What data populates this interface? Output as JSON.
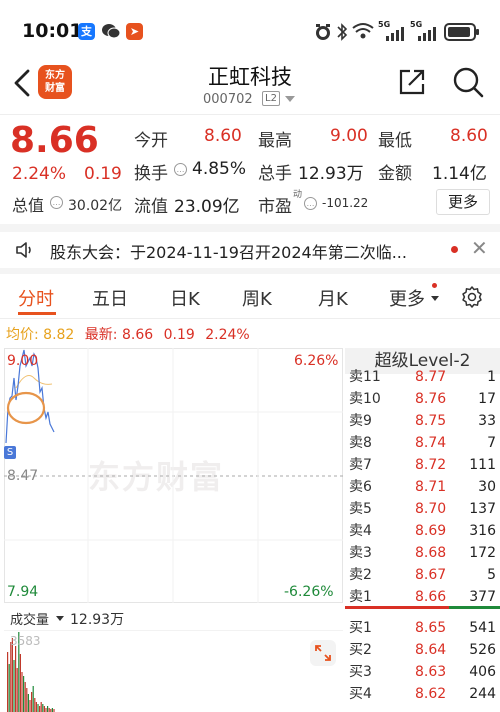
{
  "status_bar": {
    "time": "10:01",
    "app_icons": [
      "alipay-icon",
      "wechat-icon",
      "send-icon"
    ],
    "right_icons": [
      "alarm-icon",
      "bluetooth-icon",
      "wifi-icon",
      "signal-icon",
      "signal-icon",
      "battery-icon"
    ],
    "net_labels": [
      "5G",
      "5G"
    ]
  },
  "header": {
    "logo_text_1": "东方",
    "logo_text_2": "财富",
    "name": "正虹科技",
    "code": "000702",
    "level_badge": "L2"
  },
  "quote": {
    "price": "8.66",
    "change_pct": "2.24%",
    "change_val": "0.19",
    "open_label": "今开",
    "open": "8.60",
    "high_label": "最高",
    "high": "9.00",
    "low_label": "最低",
    "low": "8.60",
    "turnover_label": "换手",
    "turnover": "4.85%",
    "volume_label": "总手",
    "volume": "12.93万",
    "amount_label": "金额",
    "amount": "1.14亿",
    "total_cap_label": "总值",
    "total_cap": "30.02亿",
    "float_cap_label": "流值",
    "float_cap": "23.09亿",
    "pe_label": "市盈",
    "pe_sup": "动",
    "pe": "-101.22",
    "more_label": "更多"
  },
  "notice": {
    "text": "股东大会：于2024-11-19召开2024年第二次临..."
  },
  "tabs": [
    "分时",
    "五日",
    "日K",
    "周K",
    "月K",
    "更多"
  ],
  "summary": {
    "avg_label": "均价:",
    "avg": "8.82",
    "latest_label": "最新:",
    "latest": "8.66",
    "change_val": "0.19",
    "change_pct": "2.24%"
  },
  "chart": {
    "top_price": "9.00",
    "top_pct": "6.26%",
    "mid_price": "8.47",
    "bottom_price": "7.94",
    "bottom_pct": "-6.26%",
    "watermark": "东方财富",
    "marker": "S"
  },
  "volume": {
    "label": "成交量",
    "value": "12.93万",
    "max_label": "3583"
  },
  "colors": {
    "up": "#d93025",
    "down": "#1f8a3a",
    "brand": "#e7521e"
  },
  "order_book": {
    "title": "超级Level-2",
    "asks": [
      {
        "label": "卖11",
        "price": "8.77",
        "vol": "1"
      },
      {
        "label": "卖10",
        "price": "8.76",
        "vol": "17"
      },
      {
        "label": "卖9",
        "price": "8.75",
        "vol": "33"
      },
      {
        "label": "卖8",
        "price": "8.74",
        "vol": "7"
      },
      {
        "label": "卖7",
        "price": "8.72",
        "vol": "111"
      },
      {
        "label": "卖6",
        "price": "8.71",
        "vol": "30"
      },
      {
        "label": "卖5",
        "price": "8.70",
        "vol": "137"
      },
      {
        "label": "卖4",
        "price": "8.69",
        "vol": "316"
      },
      {
        "label": "卖3",
        "price": "8.68",
        "vol": "172"
      },
      {
        "label": "卖2",
        "price": "8.67",
        "vol": "5"
      },
      {
        "label": "卖1",
        "price": "8.66",
        "vol": "377"
      }
    ],
    "bids": [
      {
        "label": "买1",
        "price": "8.65",
        "vol": "541"
      },
      {
        "label": "买2",
        "price": "8.64",
        "vol": "526"
      },
      {
        "label": "买3",
        "price": "8.63",
        "vol": "406"
      },
      {
        "label": "买4",
        "price": "8.62",
        "vol": "244"
      }
    ]
  }
}
